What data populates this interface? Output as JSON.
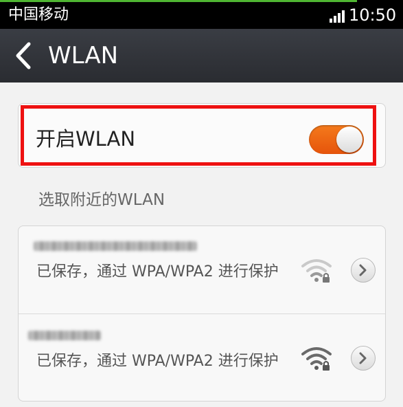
{
  "status_bar": {
    "carrier": "中国移动",
    "time": "10:50"
  },
  "header": {
    "title": "WLAN"
  },
  "wlan_toggle": {
    "label": "开启WLAN",
    "enabled": true
  },
  "section_label": "选取附近的WLAN",
  "networks": [
    {
      "status_text": "已保存，通过 WPA/WPA2 进行保护",
      "signal_icon": "wifi-weak-locked-icon"
    },
    {
      "status_text": "已保存，通过 WPA/WPA2 进行保护",
      "signal_icon": "wifi-strong-locked-icon"
    }
  ],
  "colors": {
    "switch_on": "#f06a12",
    "highlight": "#ee1111",
    "status_accent": "#4fb532"
  }
}
